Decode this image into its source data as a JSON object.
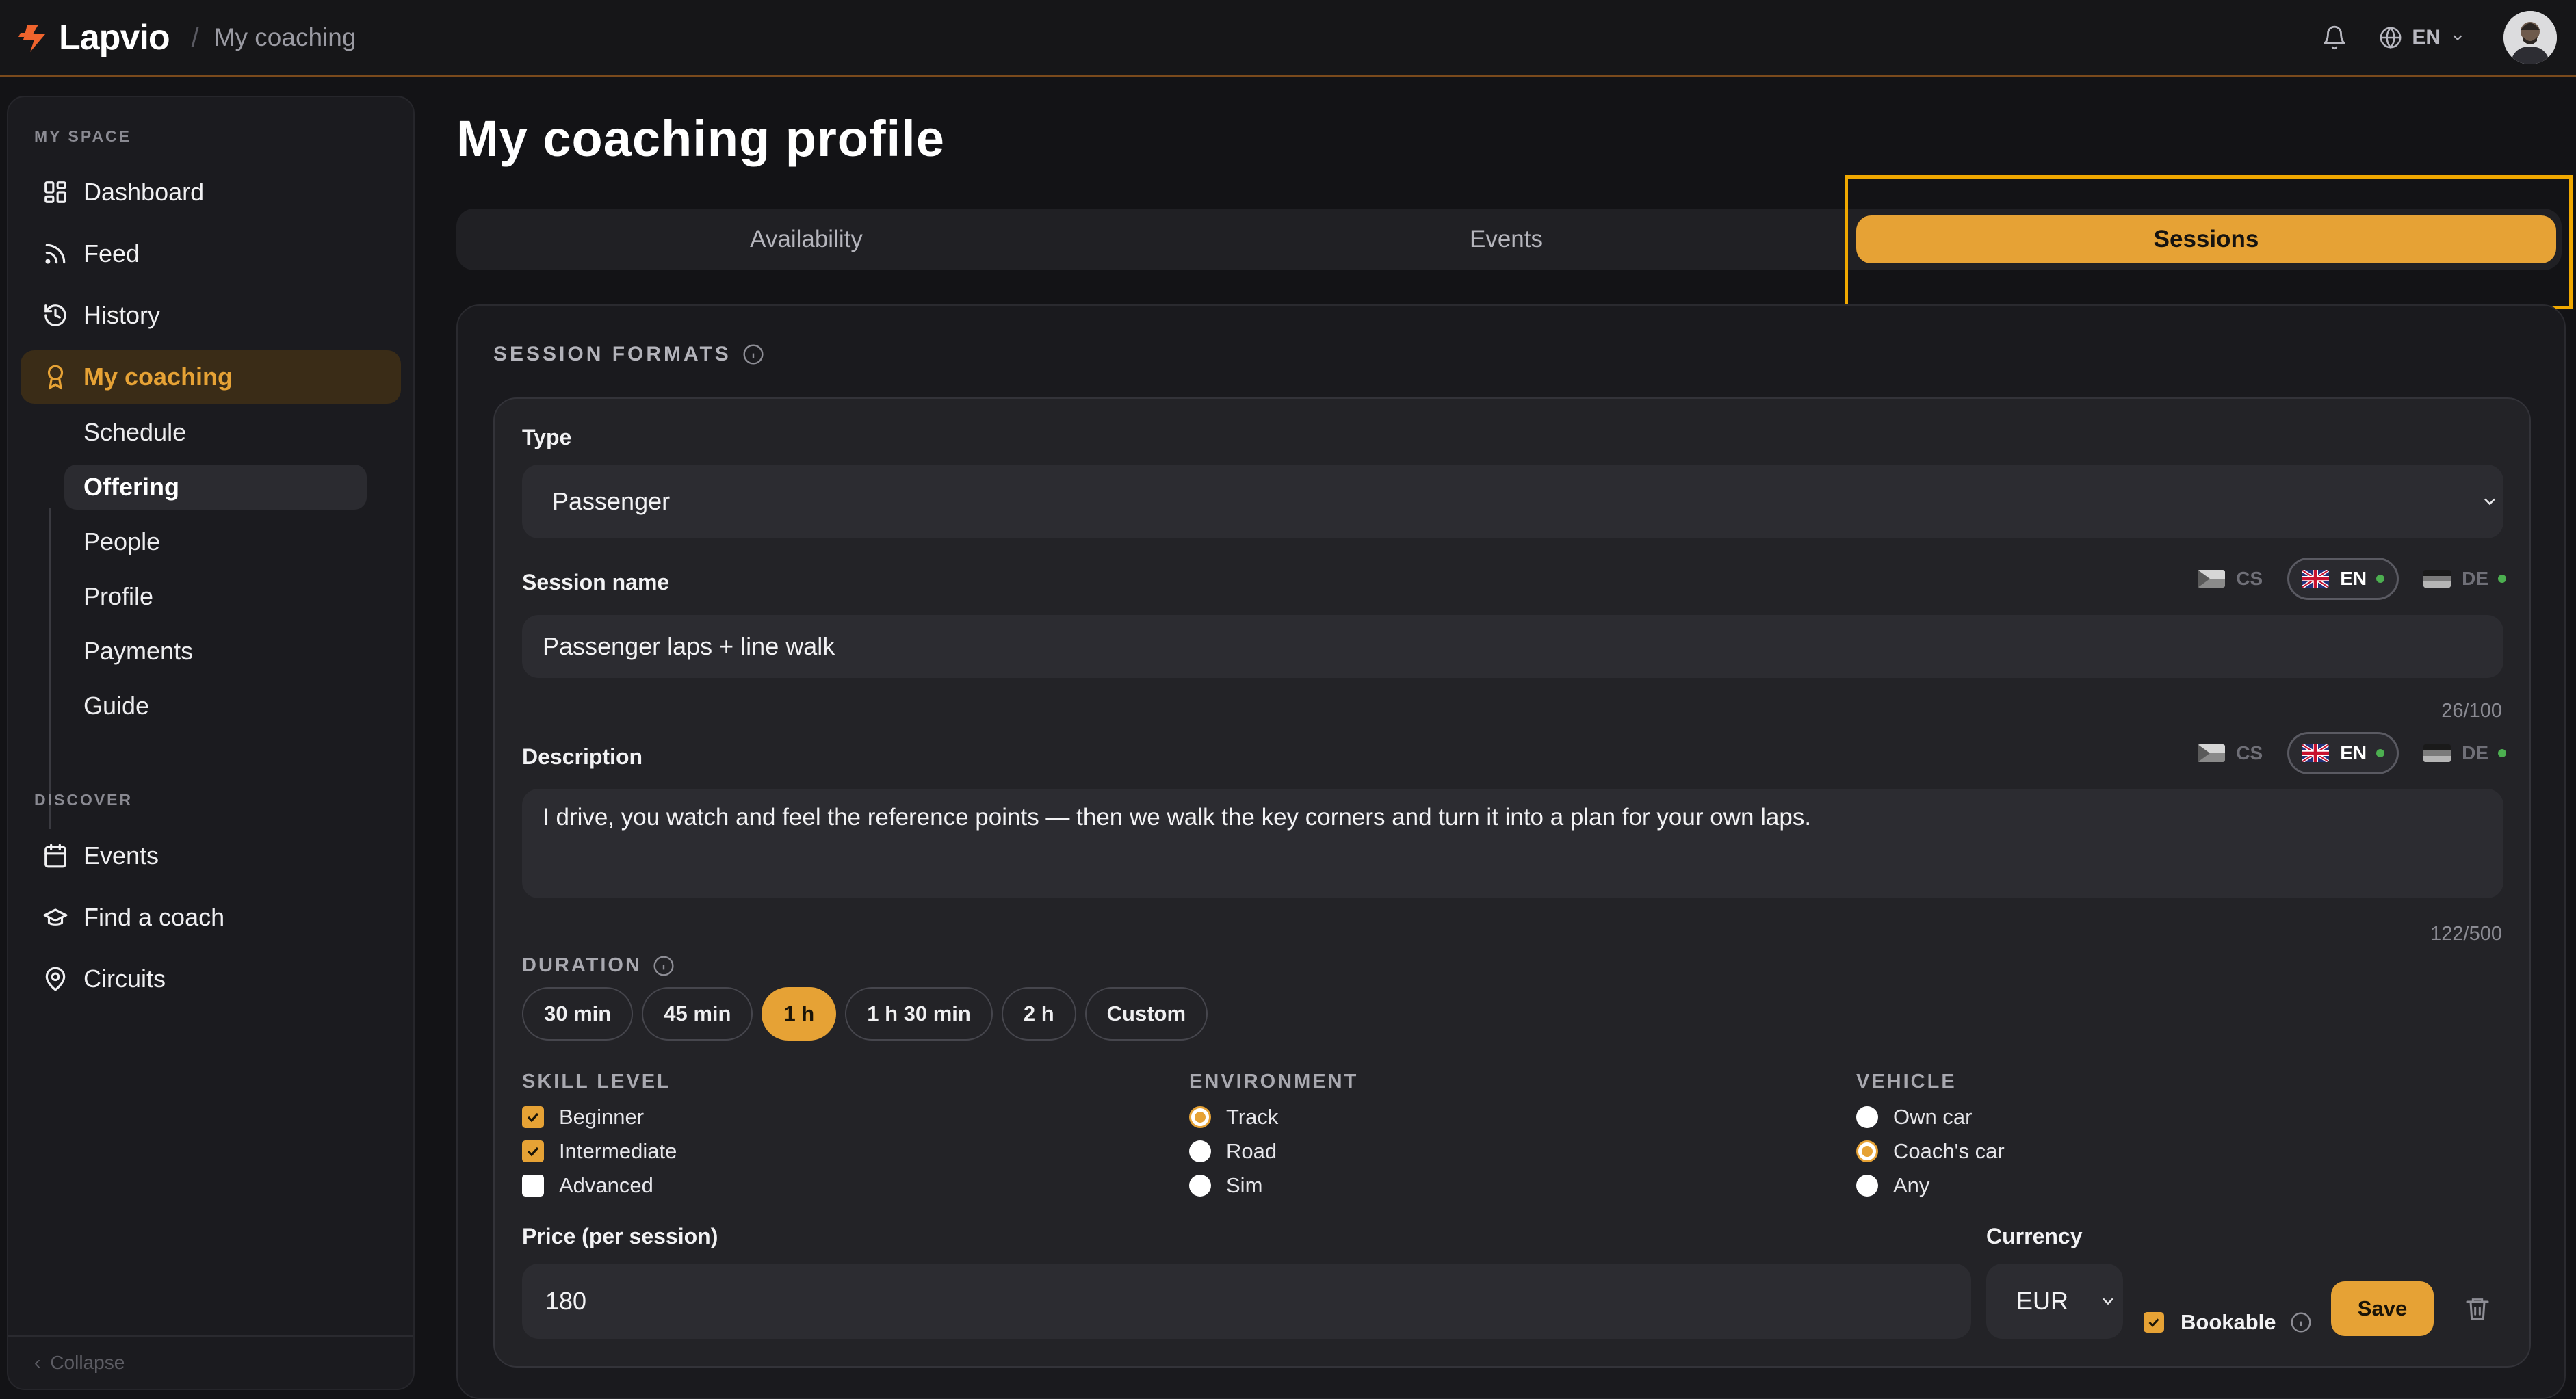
{
  "app": {
    "name": "Lapvio",
    "breadcrumb": "My coaching",
    "language": "EN"
  },
  "colors": {
    "accent": "#e6a235",
    "background": "#131316",
    "card": "#232327",
    "green_dot": "#4caf50",
    "focus_outline": "#f0a800"
  },
  "sidebar": {
    "my_space_label": "MY SPACE",
    "items": [
      {
        "label": "Dashboard",
        "icon": "grid-icon"
      },
      {
        "label": "Feed",
        "icon": "rss-icon"
      },
      {
        "label": "History",
        "icon": "history-icon"
      },
      {
        "label": "My coaching",
        "icon": "award-icon"
      }
    ],
    "sub_items": [
      {
        "label": "Schedule"
      },
      {
        "label": "Offering"
      },
      {
        "label": "People"
      },
      {
        "label": "Profile"
      },
      {
        "label": "Payments"
      },
      {
        "label": "Guide"
      }
    ],
    "discover_label": "DISCOVER",
    "discover_items": [
      {
        "label": "Events",
        "icon": "calendar-icon"
      },
      {
        "label": "Find a coach",
        "icon": "graduation-cap-icon"
      },
      {
        "label": "Circuits",
        "icon": "map-pin-icon"
      }
    ],
    "collapse_label": "Collapse"
  },
  "page": {
    "title": "My coaching profile"
  },
  "tabs": [
    {
      "label": "Availability"
    },
    {
      "label": "Events"
    },
    {
      "label": "Sessions"
    }
  ],
  "active_tab": "Sessions",
  "session_formats": {
    "title": "SESSION FORMATS",
    "type_label": "Type",
    "type_value": "Passenger",
    "session_name_label": "Session name",
    "session_name_value": "Passenger laps + line walk",
    "session_name_counter": "26/100",
    "description_label": "Description",
    "description_value": "I drive, you watch and feel the reference points — then we walk the key corners and turn it into a plan for your own laps.",
    "description_counter": "122/500",
    "languages": [
      {
        "code": "CS",
        "selected": false,
        "complete": false
      },
      {
        "code": "EN",
        "selected": true,
        "complete": true
      },
      {
        "code": "DE",
        "selected": false,
        "complete": true
      }
    ],
    "duration_label": "DURATION",
    "durations": [
      "30 min",
      "45 min",
      "1 h",
      "1 h 30 min",
      "2 h",
      "Custom"
    ],
    "duration_selected": "1 h",
    "skill_label": "SKILL LEVEL",
    "skills": [
      {
        "label": "Beginner",
        "checked": true
      },
      {
        "label": "Intermediate",
        "checked": true
      },
      {
        "label": "Advanced",
        "checked": false
      }
    ],
    "environment_label": "ENVIRONMENT",
    "environments": [
      {
        "label": "Track",
        "checked": true
      },
      {
        "label": "Road",
        "checked": false
      },
      {
        "label": "Sim",
        "checked": false
      }
    ],
    "vehicle_label": "VEHICLE",
    "vehicles": [
      {
        "label": "Own car",
        "checked": false
      },
      {
        "label": "Coach's car",
        "checked": true
      },
      {
        "label": "Any",
        "checked": false
      }
    ],
    "price_label": "Price (per session)",
    "price_value": "180",
    "currency_label": "Currency",
    "currency_value": "EUR",
    "bookable_label": "Bookable",
    "bookable_checked": true,
    "save_label": "Save"
  }
}
